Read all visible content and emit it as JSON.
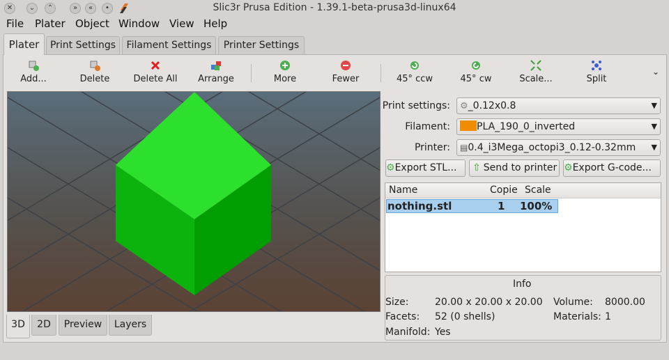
{
  "window": {
    "title": "Slic3r Prusa Edition - 1.39.1-beta-prusa3d-linux64"
  },
  "menu": [
    "File",
    "Plater",
    "Object",
    "Window",
    "View",
    "Help"
  ],
  "tabs": [
    "Plater",
    "Print Settings",
    "Filament Settings",
    "Printer Settings"
  ],
  "toolbar": {
    "add": "Add...",
    "delete": "Delete",
    "delete_all": "Delete All",
    "arrange": "Arrange",
    "more": "More",
    "fewer": "Fewer",
    "ccw": "45° ccw",
    "cw": "45° cw",
    "scale": "Scale...",
    "split": "Split"
  },
  "view_tabs": [
    "3D",
    "2D",
    "Preview",
    "Layers"
  ],
  "settings": {
    "print_label": "Print settings:",
    "print_value": "_0.12x0.8",
    "filament_label": "Filament:",
    "filament_value": "PLA_190_0_inverted",
    "filament_color": "#f08c00",
    "printer_label": "Printer:",
    "printer_value": "0.4_i3Mega_octopi3_0.12-0.32mm"
  },
  "actions": {
    "export_stl": "Export STL...",
    "send": "Send to printer",
    "export_gcode": "Export G-code..."
  },
  "objects": {
    "headers": [
      "Name",
      "Copie",
      "Scale"
    ],
    "rows": [
      {
        "name": "nothing.stl",
        "copies": "1",
        "scale": "100%"
      }
    ]
  },
  "info": {
    "title": "Info",
    "size_label": "Size:",
    "size_value": "20.00 x 20.00 x 20.00",
    "volume_label": "Volume:",
    "volume_value": "8000.00",
    "facets_label": "Facets:",
    "facets_value": "52 (0 shells)",
    "materials_label": "Materials:",
    "materials_value": "1",
    "manifold_label": "Manifold:",
    "manifold_value": "Yes"
  },
  "colors": {
    "cube_top": "#2ee02e",
    "cube_left": "#0cb30c",
    "cube_right": "#009e00"
  }
}
